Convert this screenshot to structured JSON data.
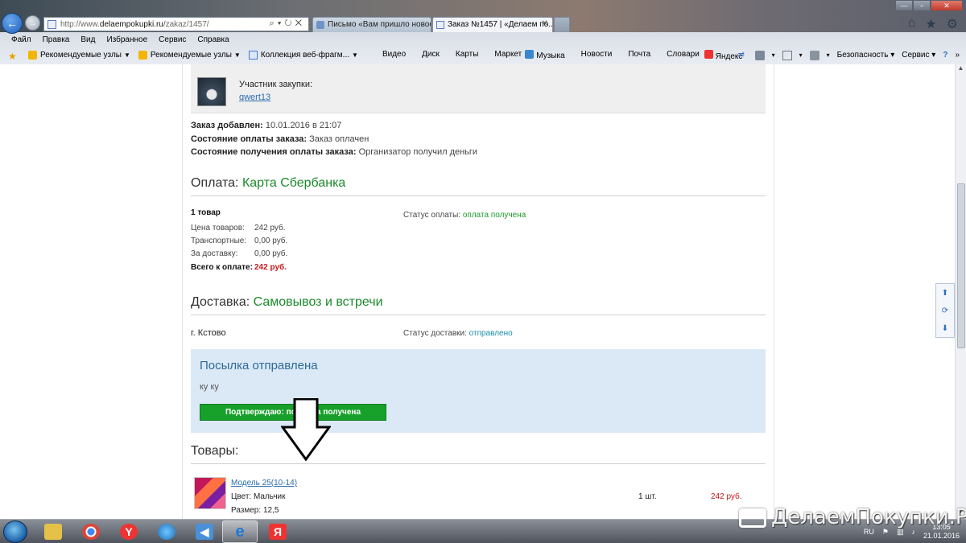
{
  "browser": {
    "url_prefix": "http://www.",
    "url_host": "delaempokupki.ru",
    "url_path": "/zakaz/1457/",
    "tabs": [
      {
        "label": "Письмо «Вам пришло новое ..."
      },
      {
        "label": "Заказ №1457 | «Делаем по..."
      }
    ],
    "menu": [
      "Файл",
      "Правка",
      "Вид",
      "Избранное",
      "Сервис",
      "Справка"
    ],
    "favorites": [
      {
        "label": "Рекомендуемые узлы",
        "icon": "bing-icon"
      },
      {
        "label": "Рекомендуемые узлы",
        "icon": "bing-icon"
      },
      {
        "label": "Коллекция веб-фрагм...",
        "icon": "web-slice-icon"
      }
    ],
    "links": [
      "Видео",
      "Диск",
      "Карты",
      "Маркет",
      "Музыка",
      "Новости",
      "Почта",
      "Словари",
      "Яндекс"
    ],
    "command": {
      "safety": "Безопасность",
      "tools": "Сервис"
    }
  },
  "order": {
    "participant_label": "Участник закупки:",
    "participant_name": "qwert13",
    "added_label": "Заказ добавлен:",
    "added_value": "10.01.2016 в 21:07",
    "pay_state_label": "Состояние оплаты заказа:",
    "pay_state_value": "Заказ оплачен",
    "receive_state_label": "Состояние получения оплаты заказа:",
    "receive_state_value": "Организатор получил деньги"
  },
  "payment": {
    "title": "Оплата:",
    "method": "Карта Сбербанка",
    "items_count": "1 товар",
    "status_label": "Статус оплаты:",
    "status_value": "оплата получена",
    "rows": [
      {
        "label": "Цена товаров:",
        "value": "242 руб."
      },
      {
        "label": "Транспортные:",
        "value": "0,00 руб."
      },
      {
        "label": "За доставку:",
        "value": "0,00 руб."
      }
    ],
    "total_label": "Всего к оплате:",
    "total_value": "242 руб."
  },
  "delivery": {
    "title": "Доставка:",
    "method": "Самовывоз и встречи",
    "city": "г. Кстово",
    "status_label": "Статус доставки:",
    "status_value": "отправлено"
  },
  "shipped": {
    "title": "Посылка отправлена",
    "note": "ку ку",
    "confirm_button": "Подтверждаю: посылка получена"
  },
  "goods": {
    "title": "Товары:",
    "product_name": "Модель 25(10-14)",
    "color_label": "Цвет:",
    "color_value": "Мальчик",
    "size_label": "Размер:",
    "size_value": "12,5",
    "qty": "1 шт.",
    "price": "242 руб."
  },
  "taskbar": {
    "lang": "RU",
    "time": "13:05",
    "date": "21.01.2016"
  },
  "watermark": "ДелаемПокупки.Ру"
}
